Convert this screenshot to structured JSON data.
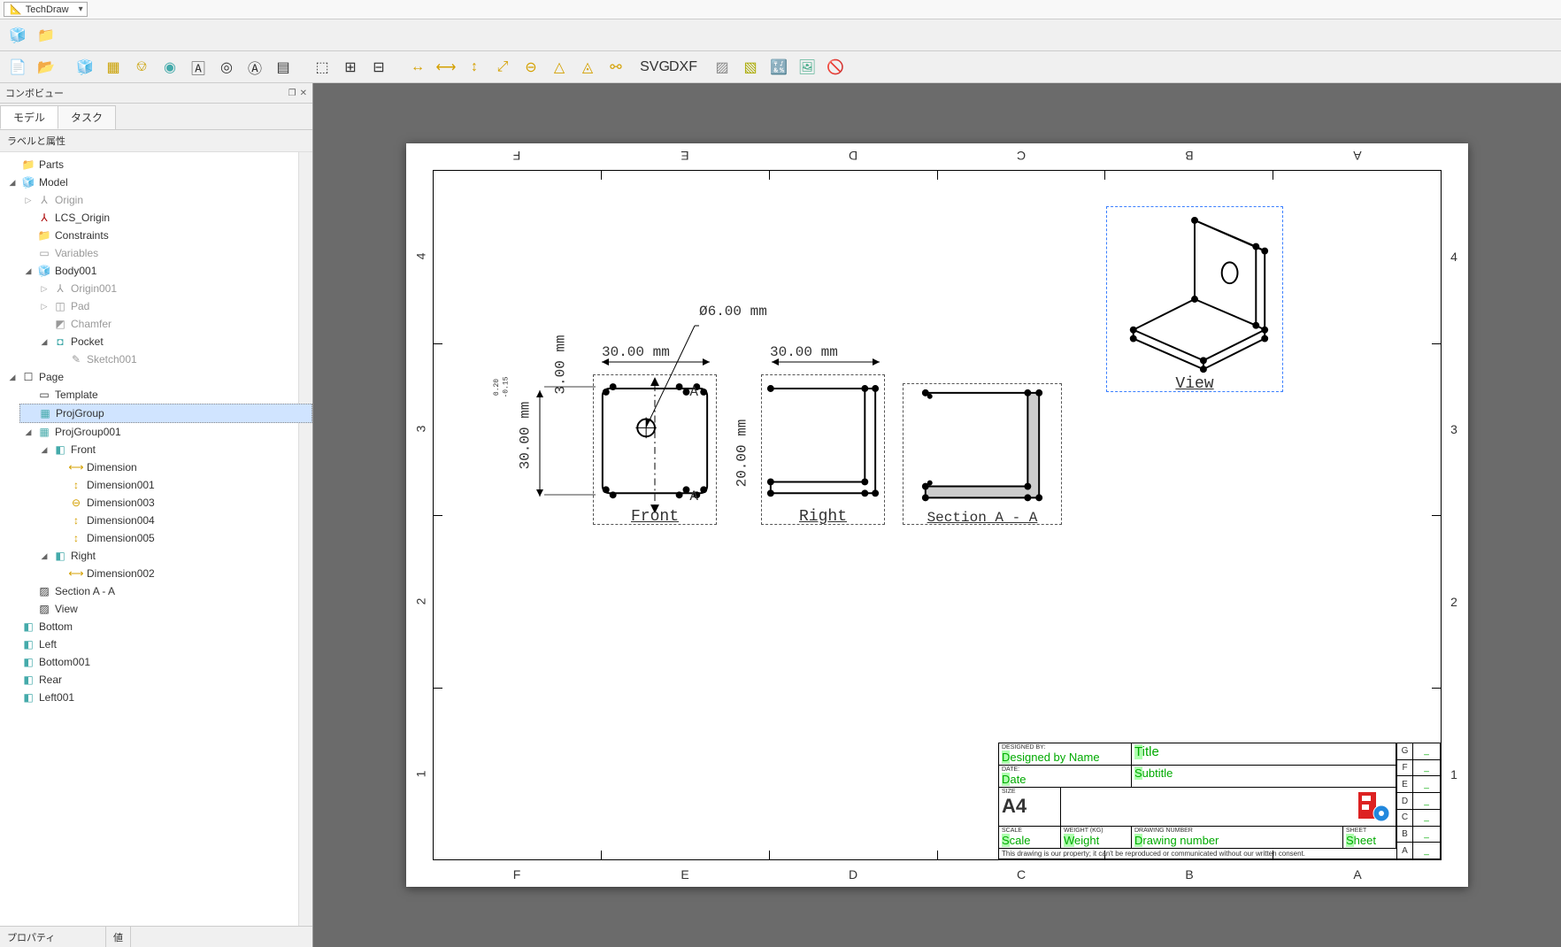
{
  "workbench": "TechDraw",
  "panel": {
    "title": "コンボビュー",
    "tab_model": "モデル",
    "tab_task": "タスク",
    "header": "ラベルと属性"
  },
  "tree": {
    "parts": "Parts",
    "model": "Model",
    "origin": "Origin",
    "lcs": "LCS_Origin",
    "constraints": "Constraints",
    "variables": "Variables",
    "body": "Body001",
    "body_origin": "Origin001",
    "pad": "Pad",
    "chamfer": "Chamfer",
    "pocket": "Pocket",
    "sketch": "Sketch001",
    "page": "Page",
    "template": "Template",
    "projgroup": "ProjGroup",
    "projgroup001": "ProjGroup001",
    "front": "Front",
    "dim": "Dimension",
    "dim001": "Dimension001",
    "dim003": "Dimension003",
    "dim004": "Dimension004",
    "dim005": "Dimension005",
    "right": "Right",
    "dim002": "Dimension002",
    "section": "Section A - A",
    "view": "View",
    "bottom": "Bottom",
    "left": "Left",
    "bottom001": "Bottom001",
    "rear": "Rear",
    "left001": "Left001"
  },
  "prop": {
    "col1": "プロパティ",
    "col2": "値"
  },
  "drawing": {
    "cols_top": [
      "F",
      "E",
      "D",
      "C",
      "B",
      "A"
    ],
    "rows": [
      "4",
      "3",
      "2",
      "1"
    ],
    "hole_dim": "Ø6.00 mm",
    "dim_30_h": "30.00 mm",
    "dim_30_v": "30.00 mm",
    "dim_3": "3.00 mm",
    "dim_20": "20.00 mm",
    "dim_30_r": "30.00 mm",
    "tol_hi": "0.20",
    "tol_lo": "-0.15",
    "front_lbl": "Front",
    "right_lbl": "Right",
    "section_lbl": "Section A - A",
    "view_lbl": "View",
    "sec_a1": "A",
    "sec_a2": "A"
  },
  "title_block": {
    "designed_by_lbl": "Designed by:",
    "designed_by": "Designed by Name",
    "date_lbl": "Date:",
    "date": "Date",
    "size_lbl": "Size",
    "size": "A4",
    "title_lbl": "",
    "title": "Title",
    "subtitle": "Subtitle",
    "scale_lbl": "Scale",
    "scale": "Scale",
    "weight_lbl": "Weight (kg)",
    "weight": "Weight",
    "dn_lbl": "Drawing Number",
    "dn": "Drawing number",
    "sheet_lbl": "Sheet",
    "sheet": "Sheet",
    "footer": "This drawing is our property; it can't be reproduced or communicated without our written consent.",
    "side": [
      "G",
      "F",
      "E",
      "D",
      "C",
      "B",
      "A"
    ],
    "side_val": "_"
  }
}
